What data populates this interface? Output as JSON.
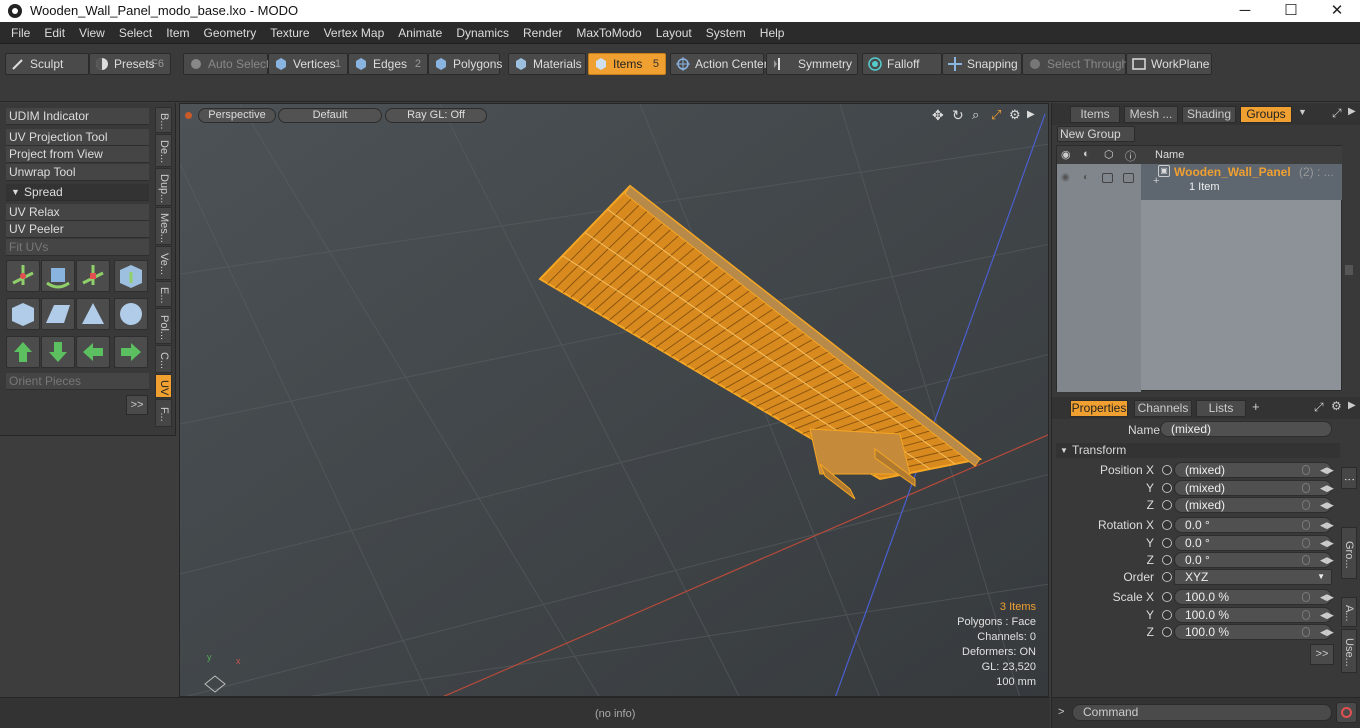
{
  "window": {
    "title": "Wooden_Wall_Panel_modo_base.lxo - MODO",
    "minimize": "─",
    "maximize": "☐",
    "close": "✕"
  },
  "menu": [
    "File",
    "Edit",
    "View",
    "Select",
    "Item",
    "Geometry",
    "Texture",
    "Vertex Map",
    "Animate",
    "Dynamics",
    "Render",
    "MaxToModo",
    "Layout",
    "System",
    "Help"
  ],
  "toolbar": {
    "sculpt": "Sculpt",
    "presets": "Presets",
    "presets_key": "F6",
    "auto_select": "Auto Select",
    "vertices": "Vertices",
    "vertices_key": "1",
    "edges": "Edges",
    "edges_key": "2",
    "polygons": "Polygons",
    "materials": "Materials",
    "items": "Items",
    "items_key": "5",
    "action_center": "Action Center",
    "symmetry": "Symmetry",
    "falloff": "Falloff",
    "snapping": "Snapping",
    "select_through": "Select Through",
    "workplane": "WorkPlane"
  },
  "left": {
    "udim": "UDIM Indicator",
    "uv_projection": "UV Projection Tool",
    "project_view": "Project from View",
    "unwrap": "Unwrap Tool",
    "spread": "Spread",
    "uv_relax": "UV Relax",
    "uv_peeler": "UV Peeler",
    "fit_uvs": "Fit UVs",
    "orient": "Orient Pieces",
    "more": ">>",
    "vtabs": [
      "B...",
      "De...",
      "Dup...",
      "Mes...",
      "Ve...",
      "E...",
      "Pol...",
      "C...",
      "UV",
      "F..."
    ]
  },
  "viewport": {
    "perspective": "Perspective",
    "default": "Default",
    "raygl": "Ray GL: Off",
    "info": {
      "items": "3 Items",
      "polygons": "Polygons : Face",
      "channels": "Channels: 0",
      "deformers": "Deformers: ON",
      "gl": "GL: 23,520",
      "scale": "100 mm"
    }
  },
  "status": {
    "info": "(no info)"
  },
  "right": {
    "tabs": [
      "Items",
      "Mesh ...",
      "Shading",
      "Groups"
    ],
    "new_group": "New Group",
    "col_name": "Name",
    "group_name": "Wooden_Wall_Panel",
    "group_count": "(2) : ...",
    "group_sub": "1 Item",
    "prop_tabs": [
      "Properties",
      "Channels",
      "Lists"
    ],
    "add": "+",
    "name_label": "Name",
    "name_value": "(mixed)",
    "transform": "Transform",
    "pos_x_l": "Position X",
    "pos_x": "(mixed)",
    "y_l": "Y",
    "pos_y": "(mixed)",
    "z_l": "Z",
    "pos_z": "(mixed)",
    "rot_x_l": "Rotation X",
    "rot_x": "0.0 °",
    "rot_y": "0.0 °",
    "rot_z": "0.0 °",
    "order_l": "Order",
    "order": "XYZ",
    "scale_x_l": "Scale X",
    "scale_x": "100.0 %",
    "scale_y": "100.0 %",
    "scale_z": "100.0 %",
    "more": ">>",
    "command": "Command",
    "rvtabs": [
      "Gro...",
      "A...",
      "Use..."
    ]
  },
  "colors": {
    "accent": "#f0a030",
    "mesh": "#f5a623"
  }
}
